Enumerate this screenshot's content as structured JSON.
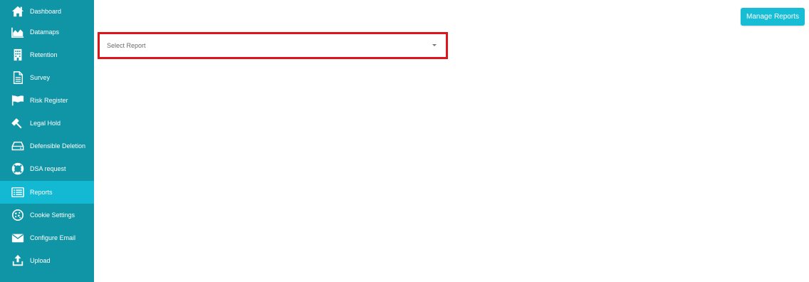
{
  "sidebar": {
    "items": [
      {
        "label": "Dashboard",
        "icon": "home-icon"
      },
      {
        "label": "Datamaps",
        "icon": "area-chart-icon"
      },
      {
        "label": "Retention",
        "icon": "building-icon"
      },
      {
        "label": "Survey",
        "icon": "document-icon"
      },
      {
        "label": "Risk Register",
        "icon": "flag-icon"
      },
      {
        "label": "Legal Hold",
        "icon": "gavel-icon"
      },
      {
        "label": "Defensible Deletion",
        "icon": "hard-drive-icon"
      },
      {
        "label": "DSA request",
        "icon": "lifebuoy-icon"
      },
      {
        "label": "Reports",
        "icon": "list-icon",
        "active": true
      },
      {
        "label": "Cookie Settings",
        "icon": "cookie-icon"
      },
      {
        "label": "Configure Email",
        "icon": "envelope-icon"
      },
      {
        "label": "Upload",
        "icon": "upload-icon"
      }
    ]
  },
  "header": {
    "manage_reports_label": "Manage Reports"
  },
  "main": {
    "report_select": {
      "placeholder": "Select Report",
      "caret_icon": "caret-down-icon"
    }
  },
  "colors": {
    "sidebar_bg": "#0f95a5",
    "sidebar_active_bg": "#13b8d3",
    "button_bg": "#17bdd5",
    "highlight_border": "#e0141c"
  }
}
